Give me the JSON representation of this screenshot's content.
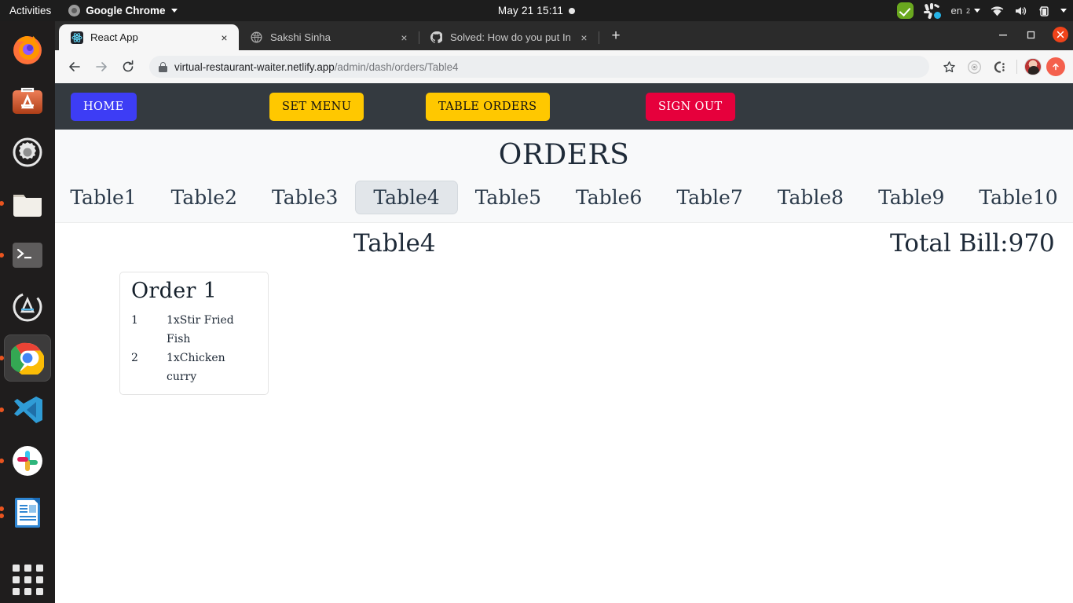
{
  "desktop": {
    "activities": "Activities",
    "app_menu": "Google Chrome",
    "clock": "May 21  15:11",
    "tray": {
      "language": "en",
      "language_sub": "2"
    },
    "dock": [
      {
        "name": "firefox",
        "label": "Firefox",
        "running": false,
        "active": false
      },
      {
        "name": "ubuntu-software",
        "label": "Ubuntu Software",
        "running": false,
        "active": false
      },
      {
        "name": "settings",
        "label": "Settings",
        "running": false,
        "active": false
      },
      {
        "name": "files",
        "label": "Files",
        "running": true,
        "active": false
      },
      {
        "name": "terminal",
        "label": "Terminal",
        "running": true,
        "active": false
      },
      {
        "name": "software-updater",
        "label": "Software Updater",
        "running": false,
        "active": false
      },
      {
        "name": "google-chrome",
        "label": "Google Chrome",
        "running": true,
        "active": true
      },
      {
        "name": "vs-code",
        "label": "Visual Studio Code",
        "running": true,
        "active": false
      },
      {
        "name": "slack",
        "label": "Slack",
        "running": true,
        "active": false
      },
      {
        "name": "libreoffice-writer",
        "label": "LibreOffice Writer",
        "running": true,
        "active": false
      }
    ]
  },
  "browser": {
    "tabs": [
      {
        "title": "React App",
        "favicon": "react-icon",
        "active": true
      },
      {
        "title": "Sakshi Sinha",
        "favicon": "globe-icon",
        "active": false
      },
      {
        "title": "Solved: How do you put In",
        "favicon": "github-icon",
        "active": false
      }
    ],
    "new_tab_label": "+",
    "close_label": "×",
    "window_controls": {
      "minimize": "—",
      "maximize": "❐",
      "close": "✕"
    },
    "omnibox": {
      "url_domain": "virtual-restaurant-waiter.netlify.app",
      "url_path": "/admin/dash/orders/Table4"
    },
    "toolbar_icons": [
      "back-icon",
      "forward-icon",
      "reload-icon",
      "bookmark-star-icon",
      "target-icon",
      "extension-icon",
      "profile-avatar",
      "upload-icon"
    ]
  },
  "app": {
    "nav": {
      "home": "HOME",
      "set_menu": "SET MENU",
      "table_orders": "TABLE ORDERS",
      "sign_out": "SIGN OUT"
    },
    "colors": {
      "navbar_bg": "#343a40",
      "home_btn": "#3d3df5",
      "yellow_btn": "#ffc800",
      "signout_btn": "#e6003c",
      "active_tab_bg": "#e2e6ea",
      "page_bg": "#f8f9fa"
    },
    "page_title": "ORDERS",
    "tables": [
      {
        "label": "Table1",
        "active": false
      },
      {
        "label": "Table2",
        "active": false
      },
      {
        "label": "Table3",
        "active": false
      },
      {
        "label": "Table4",
        "active": true
      },
      {
        "label": "Table5",
        "active": false
      },
      {
        "label": "Table6",
        "active": false
      },
      {
        "label": "Table7",
        "active": false
      },
      {
        "label": "Table8",
        "active": false
      },
      {
        "label": "Table9",
        "active": false
      },
      {
        "label": "Table10",
        "active": false
      }
    ],
    "selected_table": "Table4",
    "total_bill": "Total Bill:970",
    "orders": [
      {
        "title": "Order 1",
        "items": [
          {
            "index": "1",
            "text": "1xStir Fried Fish"
          },
          {
            "index": "2",
            "text": "1xChicken curry"
          }
        ]
      }
    ]
  }
}
